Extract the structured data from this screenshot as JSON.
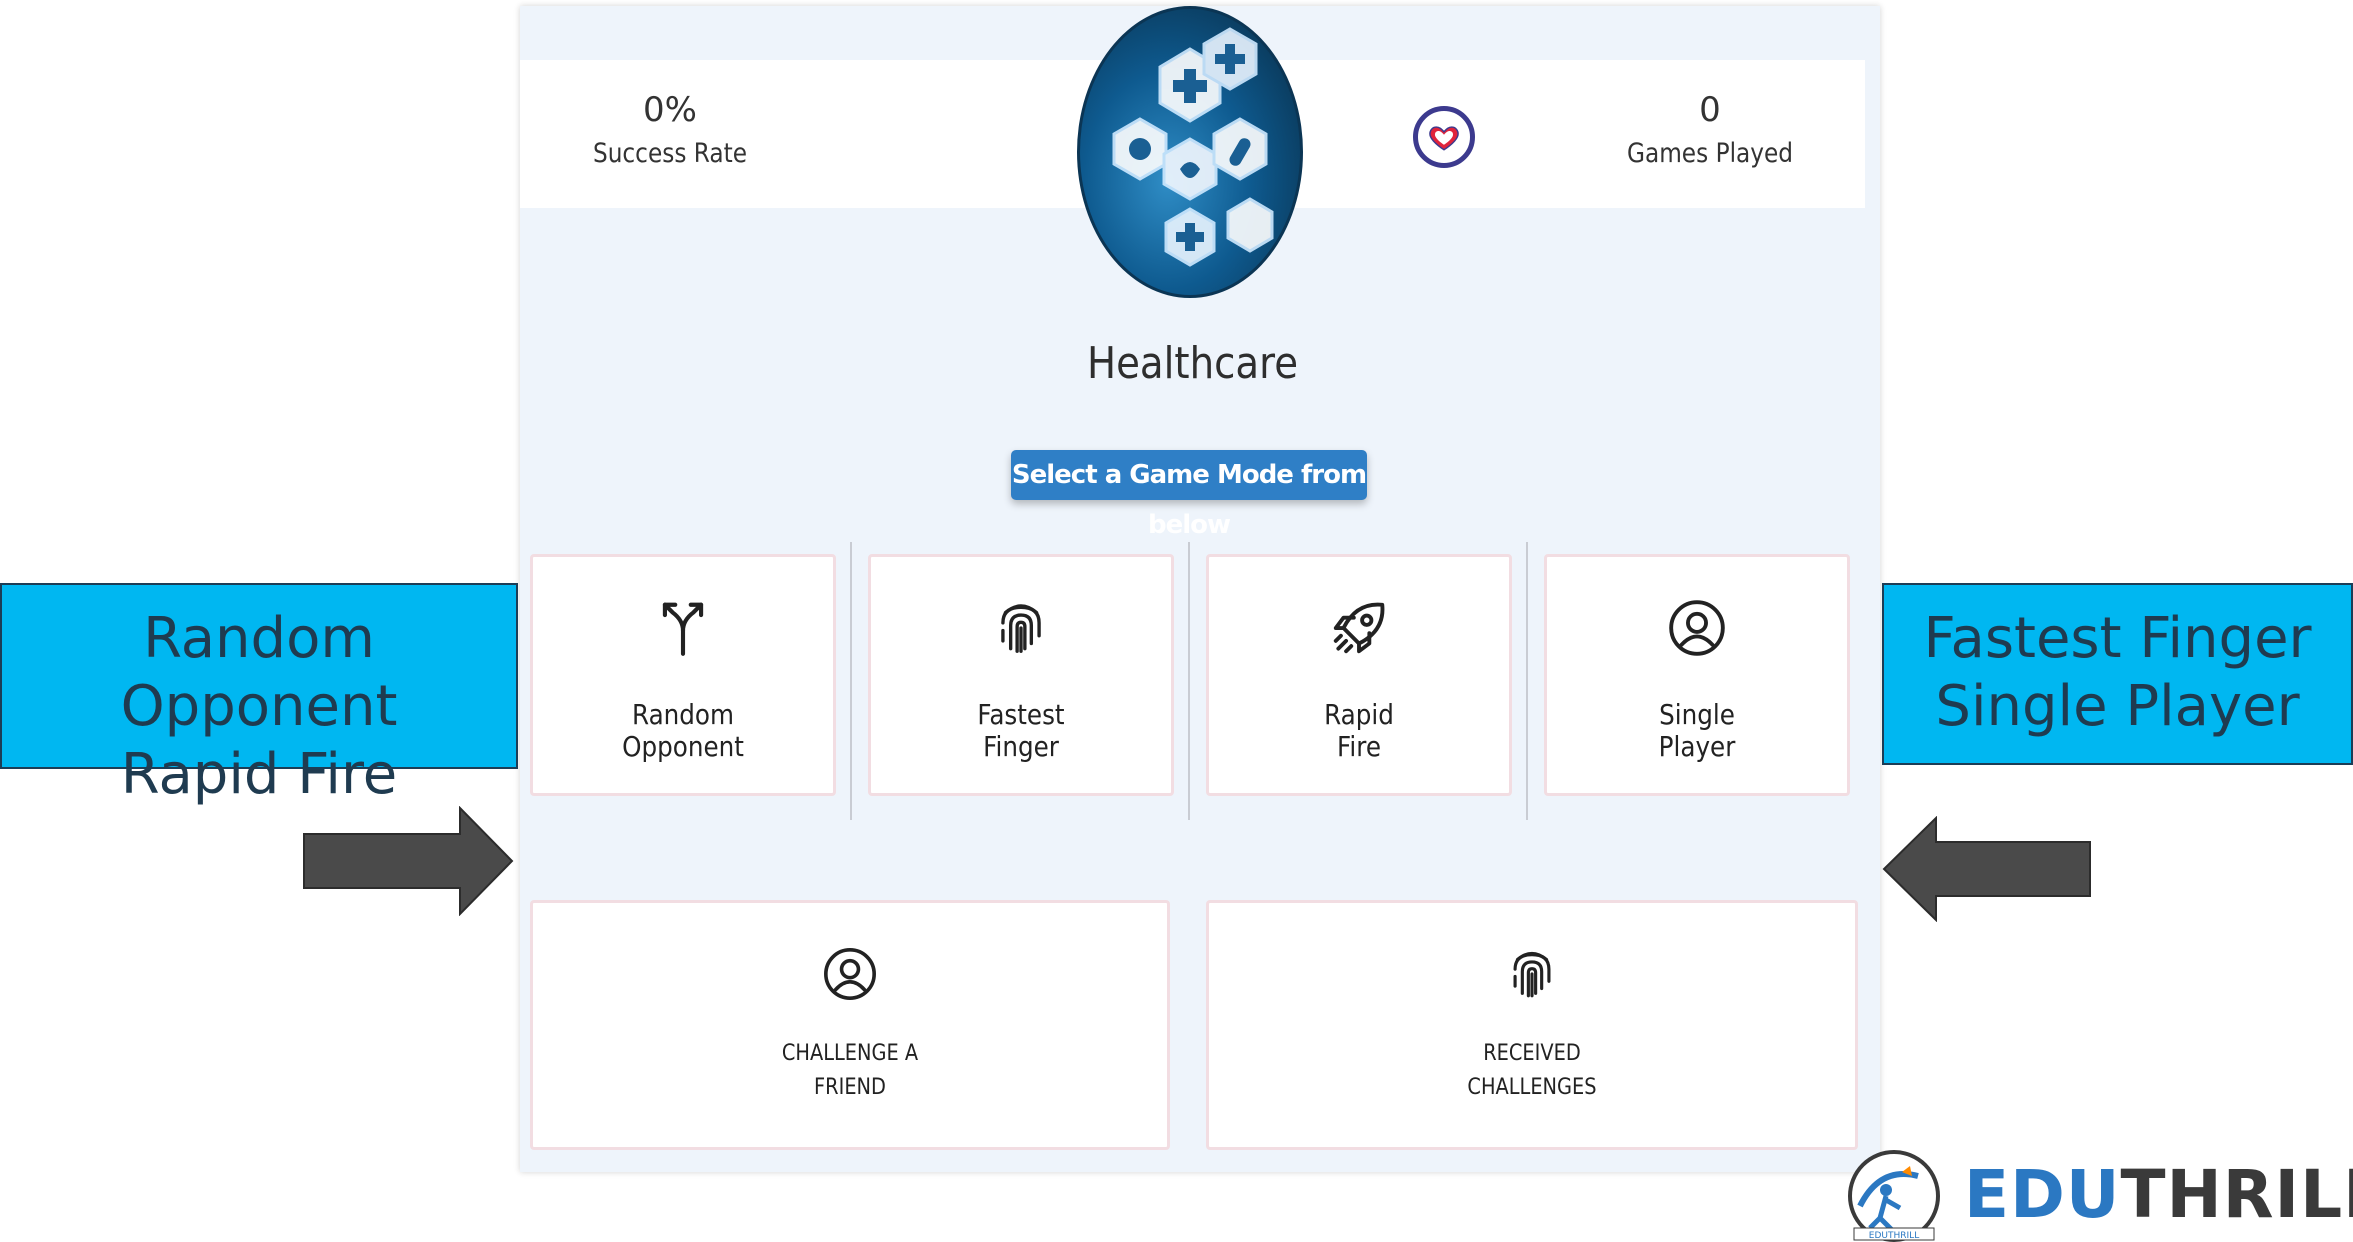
{
  "stats": {
    "success_rate_value": "0%",
    "success_rate_label": "Success Rate",
    "games_played_value": "0",
    "games_played_label": "Games Played"
  },
  "category": {
    "title": "Healthcare"
  },
  "mode_prompt": "Select a Game Mode from below",
  "game_modes": [
    {
      "line1": "Random",
      "line2": "Opponent",
      "icon": "split-arrow-icon"
    },
    {
      "line1": "Fastest",
      "line2": "Finger",
      "icon": "fingerprint-icon"
    },
    {
      "line1": "Rapid",
      "line2": "Fire",
      "icon": "rocket-icon"
    },
    {
      "line1": "Single",
      "line2": "Player",
      "icon": "user-circle-icon"
    }
  ],
  "challenges": [
    {
      "line1": "CHALLENGE A",
      "line2": "FRIEND",
      "icon": "user-circle-icon"
    },
    {
      "line1": "RECEIVED",
      "line2": "CHALLENGES",
      "icon": "fingerprint-icon"
    }
  ],
  "callouts": {
    "left_line1": "Random Opponent",
    "left_line2": "Rapid Fire",
    "right_line1": "Fastest Finger",
    "right_line2": "Single Player"
  },
  "brand": {
    "name_part1": "EDU",
    "name_part2": "THRILL",
    "badge_text": "EDUTHRILL"
  },
  "colors": {
    "accent_blue": "#2f7fc6",
    "callout_cyan": "#00b7f1",
    "heart_red": "#e0243c",
    "heart_ring": "#3c3a8e",
    "brand_blue": "#2b78c2",
    "brand_gray": "#3a3a3a"
  }
}
